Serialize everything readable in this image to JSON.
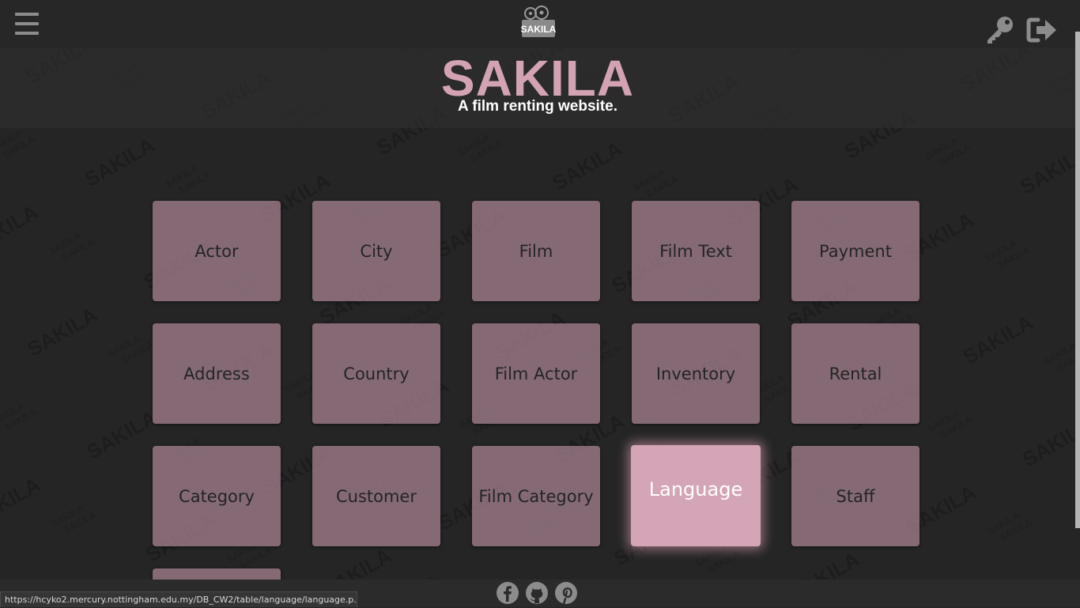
{
  "header": {
    "menu_icon": "hamburger-menu-icon",
    "logo_text": "SAKILA",
    "key_icon": "key-icon",
    "logout_icon": "logout-icon"
  },
  "hero": {
    "title": "SAKILA",
    "subtitle": "A film renting website."
  },
  "watermark_text": "SAKILA",
  "tables": [
    {
      "label": "Actor"
    },
    {
      "label": "City"
    },
    {
      "label": "Film"
    },
    {
      "label": "Film Text"
    },
    {
      "label": "Payment"
    },
    {
      "label": "Address"
    },
    {
      "label": "Country"
    },
    {
      "label": "Film Actor"
    },
    {
      "label": "Inventory"
    },
    {
      "label": "Rental"
    },
    {
      "label": "Category"
    },
    {
      "label": "Customer"
    },
    {
      "label": "Film Category"
    },
    {
      "label": "Language",
      "hovered": true
    },
    {
      "label": "Staff"
    }
  ],
  "footer": {
    "social_icons": [
      "facebook-icon",
      "github-icon",
      "pinterest-icon"
    ]
  },
  "status_bar": {
    "url": "https://hcyko2.mercury.nottingham.edu.my/DB_CW2/table/language/language.p..."
  },
  "colors": {
    "background": "#252525",
    "accent": "#d3a3b4",
    "tile": "#a07e8c",
    "tile_hover": "#d4a5b6"
  }
}
